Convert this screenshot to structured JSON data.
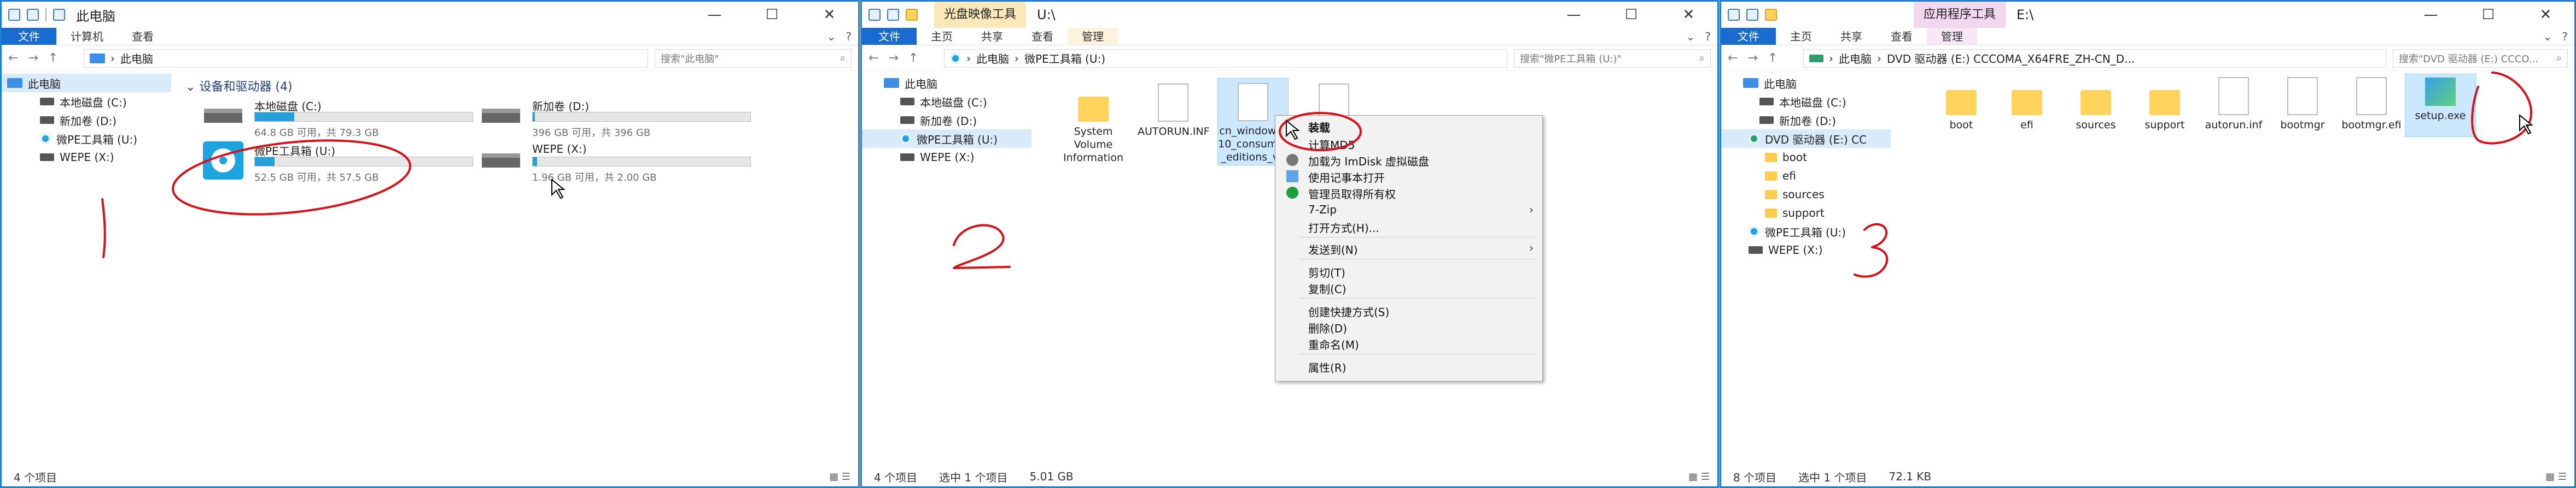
{
  "window1": {
    "title": "此电脑",
    "ribbon_tabs": [
      "文件",
      "计算机",
      "查看"
    ],
    "address_path": "此电脑",
    "search_placeholder": "搜索\"此电脑\"",
    "sidebar": [
      "此电脑",
      "本地磁盘 (C:)",
      "新加卷 (D:)",
      "微PE工具箱 (U:)",
      "WEPE (X:)"
    ],
    "section_title": "设备和驱动器 (4)",
    "drives": [
      {
        "name": "本地磁盘 (C:)",
        "size_text": "64.8 GB 可用，共 79.3 GB",
        "used_fraction": 0.18
      },
      {
        "name": "新加卷 (D:)",
        "size_text": "396 GB 可用，共 396 GB",
        "used_fraction": 0.01
      },
      {
        "name": "微PE工具箱 (U:)",
        "size_text": "52.5 GB 可用，共 57.5 GB",
        "used_fraction": 0.09
      },
      {
        "name": "WEPE (X:)",
        "size_text": "1.96 GB 可用，共 2.00 GB",
        "used_fraction": 0.02
      }
    ],
    "status": "4 个项目",
    "annotation_number": "1"
  },
  "window2": {
    "context_tab": "光盘映像工具",
    "title": "U:\\",
    "ribbon_tabs": [
      "文件",
      "主页",
      "共享",
      "查看",
      "管理"
    ],
    "address_path": "微PE工具箱 (U:)",
    "address_root": "此电脑",
    "search_placeholder": "搜索\"微PE工具箱 (U:)\"",
    "sidebar": [
      "此电脑",
      "本地磁盘 (C:)",
      "新加卷 (D:)",
      "微PE工具箱 (U:)",
      "WEPE (X:)"
    ],
    "files": [
      {
        "name": "System Volume Information",
        "kind": "folder"
      },
      {
        "name": "AUTORUN.INF",
        "kind": "doc"
      },
      {
        "name": "cn_windows_10_consumer_editions_ver...",
        "kind": "disc"
      },
      {
        "name": "",
        "kind": "disc"
      }
    ],
    "status": "4 个项目",
    "selection": "选中 1 个项目",
    "selection_size": "5.01 GB",
    "context_menu": [
      "装载",
      "计算MD5",
      "加载为 ImDisk 虚拟磁盘",
      "使用记事本打开",
      "管理员取得所有权",
      "7-Zip",
      "打开方式(H)...",
      "发送到(N)",
      "剪切(T)",
      "复制(C)",
      "创建快捷方式(S)",
      "删除(D)",
      "重命名(M)",
      "属性(R)"
    ],
    "annotation_number": "2"
  },
  "window3": {
    "context_tab": "应用程序工具",
    "title": "E:\\",
    "ribbon_tabs": [
      "文件",
      "主页",
      "共享",
      "查看",
      "管理"
    ],
    "address_root": "此电脑",
    "address_path": "DVD 驱动器 (E:) CCCOMA_X64FRE_ZH-CN_D...",
    "search_placeholder": "搜索\"DVD 驱动器 (E:) CCCO...",
    "sidebar": [
      "此电脑",
      "本地磁盘 (C:)",
      "新加卷 (D:)",
      "DVD 驱动器 (E:) CC",
      "boot",
      "efi",
      "sources",
      "support",
      "微PE工具箱 (U:)",
      "WEPE (X:)"
    ],
    "files": [
      {
        "name": "boot",
        "kind": "folder"
      },
      {
        "name": "efi",
        "kind": "folder"
      },
      {
        "name": "sources",
        "kind": "folder"
      },
      {
        "name": "support",
        "kind": "folder"
      },
      {
        "name": "autorun.inf",
        "kind": "cfg"
      },
      {
        "name": "bootmgr",
        "kind": "doc"
      },
      {
        "name": "bootmgr.efi",
        "kind": "doc"
      },
      {
        "name": "setup.exe",
        "kind": "exe"
      }
    ],
    "status": "8 个项目",
    "selection": "选中 1 个项目",
    "selection_size": "72.1 KB",
    "annotation_number": "3"
  },
  "window_controls": [
    "—",
    "☐",
    "✕"
  ],
  "help_icons": [
    "⌄",
    "?"
  ],
  "nav_buttons": [
    "←",
    "→",
    "↑"
  ],
  "colors": {
    "accent": "#1e7fd2",
    "selection": "#cce8ff",
    "annotation": "#d8101a",
    "progress": "#26a0da"
  }
}
